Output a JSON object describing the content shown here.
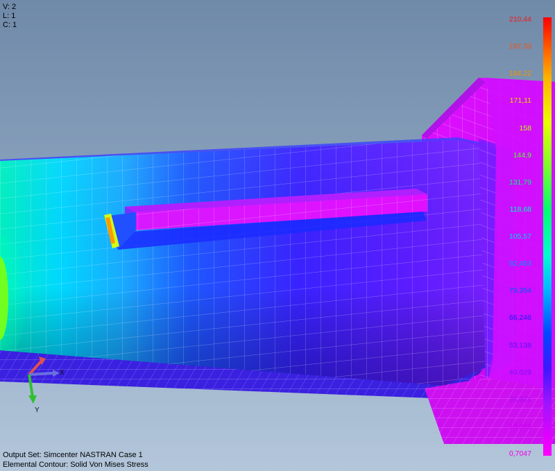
{
  "viewport_info": {
    "view": "V: 2",
    "layer": "L: 1",
    "color": "C: 1"
  },
  "legend": {
    "ticks": [
      {
        "label": "210,44",
        "color": "#ff2020"
      },
      {
        "label": "197,33",
        "color": "#ff5a1a"
      },
      {
        "label": "184,22",
        "color": "#ff9a00"
      },
      {
        "label": "171,11",
        "color": "#e8e000"
      },
      {
        "label": "158",
        "color": "#c8ff00"
      },
      {
        "label": "144,9",
        "color": "#60ff30"
      },
      {
        "label": "131,79",
        "color": "#00ff80"
      },
      {
        "label": "118,68",
        "color": "#00ffc8"
      },
      {
        "label": "105,57",
        "color": "#00d8ff"
      },
      {
        "label": "92,463",
        "color": "#00a0ff"
      },
      {
        "label": "79,354",
        "color": "#0060ff"
      },
      {
        "label": "66,246",
        "color": "#2020ff"
      },
      {
        "label": "53,138",
        "color": "#5a18ff"
      },
      {
        "label": "40,029",
        "color": "#8a14ff"
      },
      {
        "label": "26,921",
        "color": "#b010ff"
      },
      {
        "label": "13,813",
        "color": "#d800ff"
      },
      {
        "label": "0,7047",
        "color": "#ff00ff"
      }
    ]
  },
  "triad": {
    "x_label": "X",
    "y_label": "Y"
  },
  "status": {
    "output_set": "Output Set: Simcenter NASTRAN Case 1",
    "contour": "Elemental Contour: Solid Von Mises Stress"
  }
}
